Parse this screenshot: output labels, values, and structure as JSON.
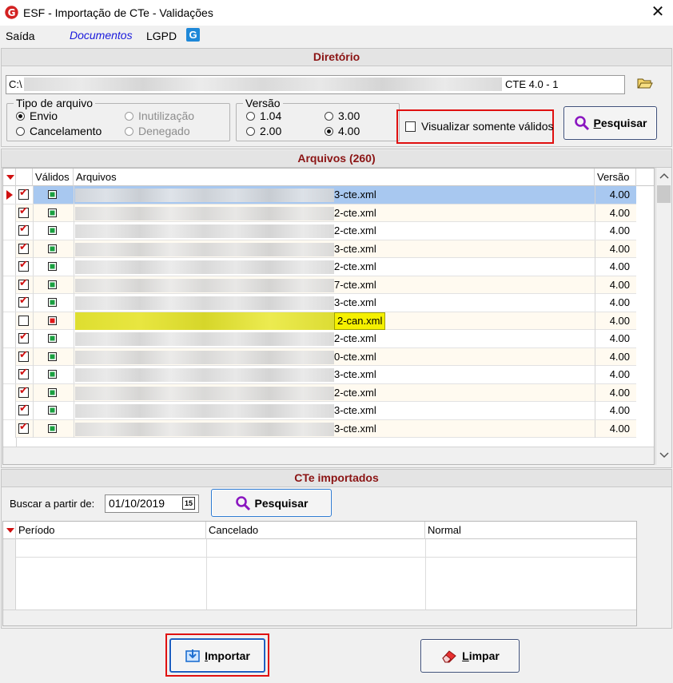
{
  "window": {
    "title": "ESF - Importação de CTe - Validações",
    "close_glyph": "✕"
  },
  "menu": {
    "saida": "Saída",
    "documentos": "Documentos",
    "lgpd": "LGPD",
    "lgpd_icon_letter": "G"
  },
  "diretorio": {
    "header": "Diretório",
    "path_prefix": "C:\\",
    "path_suffix": "CTE 4.0 - 1"
  },
  "tipo_arquivo": {
    "legend": "Tipo de arquivo",
    "options": [
      {
        "label": "Envio",
        "selected": true,
        "enabled": true
      },
      {
        "label": "Cancelamento",
        "selected": false,
        "enabled": true
      },
      {
        "label": "Inutilização",
        "selected": false,
        "enabled": false
      },
      {
        "label": "Denegado",
        "selected": false,
        "enabled": false
      }
    ]
  },
  "versao": {
    "legend": "Versão",
    "options": [
      {
        "label": "1.04",
        "selected": false
      },
      {
        "label": "2.00",
        "selected": false
      },
      {
        "label": "3.00",
        "selected": false
      },
      {
        "label": "4.00",
        "selected": true
      }
    ]
  },
  "visualizar": {
    "label": "Visualizar somente válidos",
    "checked": false
  },
  "pesquisar_label_rest": "esquisar",
  "pesquisar_label_mnemonic": "P",
  "arquivos": {
    "header": "Arquivos (260)",
    "columns": {
      "validos": "Válidos",
      "arquivos": "Arquivos",
      "versao": "Versão"
    },
    "rows": [
      {
        "checked": true,
        "valid": true,
        "suffix": "3-cte.xml",
        "versao": "4.00",
        "selected": true
      },
      {
        "checked": true,
        "valid": true,
        "suffix": "2-cte.xml",
        "versao": "4.00"
      },
      {
        "checked": true,
        "valid": true,
        "suffix": "2-cte.xml",
        "versao": "4.00"
      },
      {
        "checked": true,
        "valid": true,
        "suffix": "3-cte.xml",
        "versao": "4.00"
      },
      {
        "checked": true,
        "valid": true,
        "suffix": "2-cte.xml",
        "versao": "4.00"
      },
      {
        "checked": true,
        "valid": true,
        "suffix": "7-cte.xml",
        "versao": "4.00"
      },
      {
        "checked": true,
        "valid": true,
        "suffix": "3-cte.xml",
        "versao": "4.00"
      },
      {
        "checked": false,
        "valid": false,
        "suffix": "2-can.xml",
        "versao": "4.00",
        "highlight": true
      },
      {
        "checked": true,
        "valid": true,
        "suffix": "2-cte.xml",
        "versao": "4.00"
      },
      {
        "checked": true,
        "valid": true,
        "suffix": "0-cte.xml",
        "versao": "4.00"
      },
      {
        "checked": true,
        "valid": true,
        "suffix": "3-cte.xml",
        "versao": "4.00"
      },
      {
        "checked": true,
        "valid": true,
        "suffix": "2-cte.xml",
        "versao": "4.00"
      },
      {
        "checked": true,
        "valid": true,
        "suffix": "3-cte.xml",
        "versao": "4.00"
      },
      {
        "checked": true,
        "valid": true,
        "suffix": "3-cte.xml",
        "versao": "4.00"
      }
    ]
  },
  "cte_importados": {
    "header": "CTe importados",
    "buscar_label": "Buscar a partir de:",
    "date_value": "01/10/2019",
    "calendar_glyph": "15",
    "pesquisar_label": "Pesquisar",
    "columns": {
      "periodo": "Período",
      "cancelado": "Cancelado",
      "normal": "Normal"
    }
  },
  "bottom": {
    "importar_mnemonic": "I",
    "importar_rest": "mportar",
    "limpar_mnemonic": "L",
    "limpar_rest": "impar"
  },
  "colors": {
    "accent_red": "#8b1414",
    "valid_green": "#1aa040",
    "invalid_red": "#e01818",
    "highlight_yellow": "#f5f000",
    "selected_row": "#a8c8f0"
  }
}
